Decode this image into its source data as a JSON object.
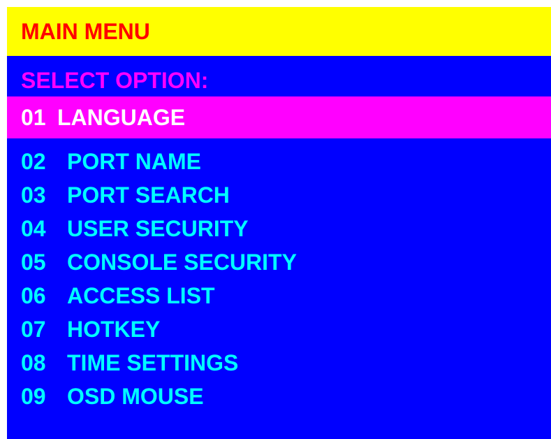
{
  "colors": {
    "screen_background": "#0000ff",
    "title_background": "#ffff00",
    "title_text": "#ff0000",
    "prompt_text": "#ff00ff",
    "item_text": "#00ffff",
    "selected_background": "#ff00ff",
    "selected_text": "#ffffff"
  },
  "title": "MAIN MENU",
  "prompt": "SELECT OPTION:",
  "menu": {
    "selected_index": 0,
    "items": [
      {
        "num": "01",
        "label": "LANGUAGE"
      },
      {
        "num": "02",
        "label": "PORT NAME"
      },
      {
        "num": "03",
        "label": "PORT SEARCH"
      },
      {
        "num": "04",
        "label": "USER SECURITY"
      },
      {
        "num": "05",
        "label": "CONSOLE SECURITY"
      },
      {
        "num": "06",
        "label": "ACCESS LIST"
      },
      {
        "num": "07",
        "label": "HOTKEY"
      },
      {
        "num": "08",
        "label": "TIME SETTINGS"
      },
      {
        "num": "09",
        "label": "OSD MOUSE"
      }
    ]
  }
}
